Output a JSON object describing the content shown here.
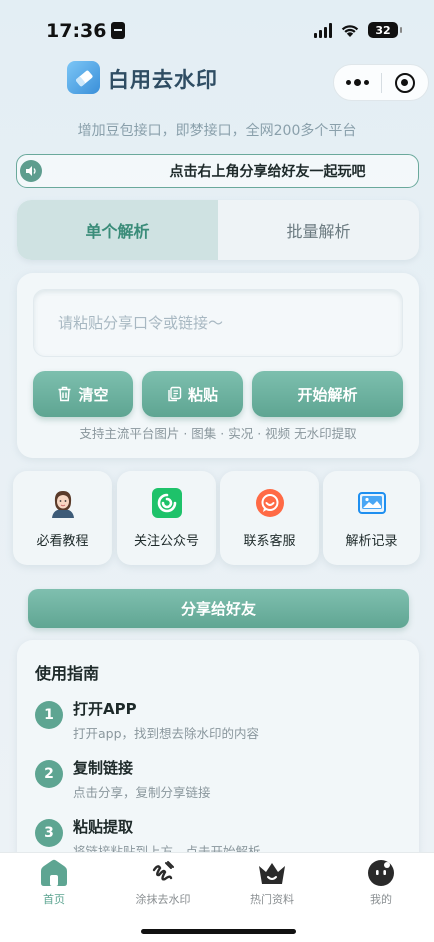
{
  "status_bar": {
    "time": "17:36",
    "battery": "32"
  },
  "header": {
    "app_title": "白用去水印"
  },
  "subtitle": "增加豆包接口，即梦接口，全网200多个平台",
  "notice": {
    "text": "点击右上角分享给好友一起玩吧"
  },
  "tabs": [
    {
      "label": "单个解析",
      "active": true
    },
    {
      "label": "批量解析",
      "active": false
    }
  ],
  "parse": {
    "input_value": "",
    "input_placeholder": "请粘贴分享口令或链接～",
    "clear_label": "清空",
    "paste_label": "粘贴",
    "start_label": "开始解析",
    "support_text": "支持主流平台图片 · 图集 · 实况 · 视频 无水印提取"
  },
  "quick_actions": [
    {
      "label": "必看教程",
      "icon": "tutorial-avatar-icon"
    },
    {
      "label": "关注公众号",
      "icon": "wechat-official-icon"
    },
    {
      "label": "联系客服",
      "icon": "customer-service-icon"
    },
    {
      "label": "解析记录",
      "icon": "history-image-icon"
    }
  ],
  "share_button": "分享给好友",
  "guide": {
    "title": "使用指南",
    "steps": [
      {
        "num": "1",
        "title": "打开APP",
        "desc": "打开app，找到想去除水印的内容"
      },
      {
        "num": "2",
        "title": "复制链接",
        "desc": "点击分享，复制分享链接"
      },
      {
        "num": "3",
        "title": "粘贴提取",
        "desc": "将链接粘贴到上方，点击开始解析"
      }
    ]
  },
  "bottom_nav": [
    {
      "label": "首页",
      "icon": "home-icon",
      "active": true
    },
    {
      "label": "涂抹去水印",
      "icon": "smear-icon",
      "active": false
    },
    {
      "label": "热门资料",
      "icon": "crown-icon",
      "active": false
    },
    {
      "label": "我的",
      "icon": "profile-icon",
      "active": false
    }
  ],
  "colors": {
    "accent": "#5ea592",
    "tab_active_bg": "#cfe2e2",
    "title": "#2f4d63"
  }
}
